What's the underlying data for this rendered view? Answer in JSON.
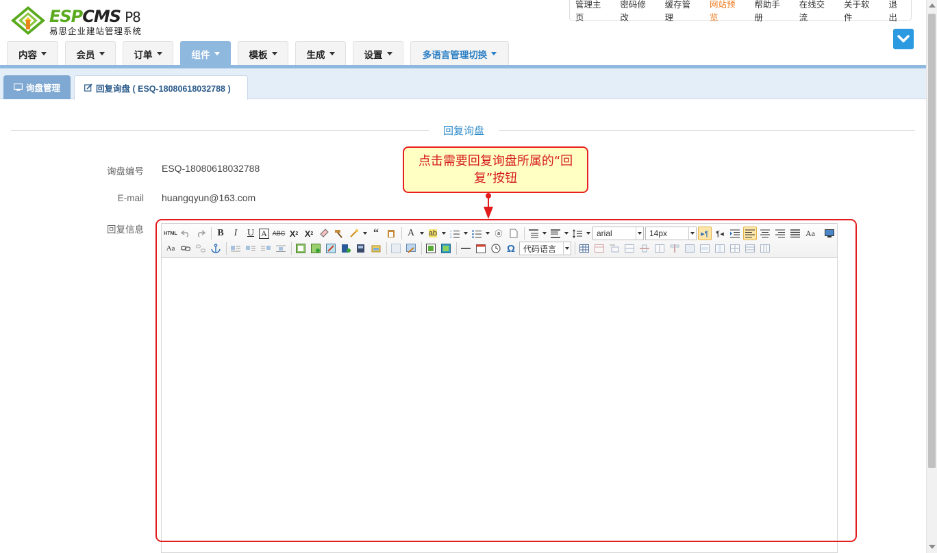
{
  "header": {
    "logo": {
      "brand_green": "ESP",
      "brand_dark": "CMS",
      "version": "P8",
      "subtitle": "易思企业建站管理系统"
    },
    "top_links": [
      {
        "label": "管理主页",
        "highlight": false
      },
      {
        "label": "密码修改",
        "highlight": false
      },
      {
        "label": "缓存管理",
        "highlight": false
      },
      {
        "label": "网站预览",
        "highlight": true
      },
      {
        "label": "帮助手册",
        "highlight": false
      },
      {
        "label": "在线交流",
        "highlight": false
      },
      {
        "label": "关于软件",
        "highlight": false
      },
      {
        "label": "退出",
        "highlight": false
      }
    ],
    "main_nav": [
      {
        "label": "内容",
        "active": false
      },
      {
        "label": "会员",
        "active": false
      },
      {
        "label": "订单",
        "active": false
      },
      {
        "label": "组件",
        "active": true
      },
      {
        "label": "模板",
        "active": false
      },
      {
        "label": "生成",
        "active": false
      },
      {
        "label": "设置",
        "active": false
      },
      {
        "label": "多语言管理切换",
        "active": false
      }
    ]
  },
  "tabs": {
    "inquiry_mgmt": "询盘管理",
    "reply_tab": "回复询盘 ( ESQ-18080618032788 )"
  },
  "form": {
    "section_title": "回复询盘",
    "inquiry_no_label": "询盘编号",
    "inquiry_no_value": "ESQ-18080618032788",
    "email_label": "E-mail",
    "email_value": "huangqyun@163.com",
    "reply_label": "回复信息"
  },
  "editor": {
    "font_family": "arial",
    "font_size": "14px",
    "code_language": "代码语言",
    "html_button": "HTML"
  },
  "annotation": {
    "text": "点击需要回复询盘所属的“回复”按钮"
  },
  "colors": {
    "accent_blue": "#2b88c8",
    "nav_active": "#8fb8df",
    "highlight_orange": "#f07a1e",
    "annotation_red": "#e21c1c",
    "annotation_bg": "#ffffc4",
    "logo_green": "#5aaa1e"
  }
}
